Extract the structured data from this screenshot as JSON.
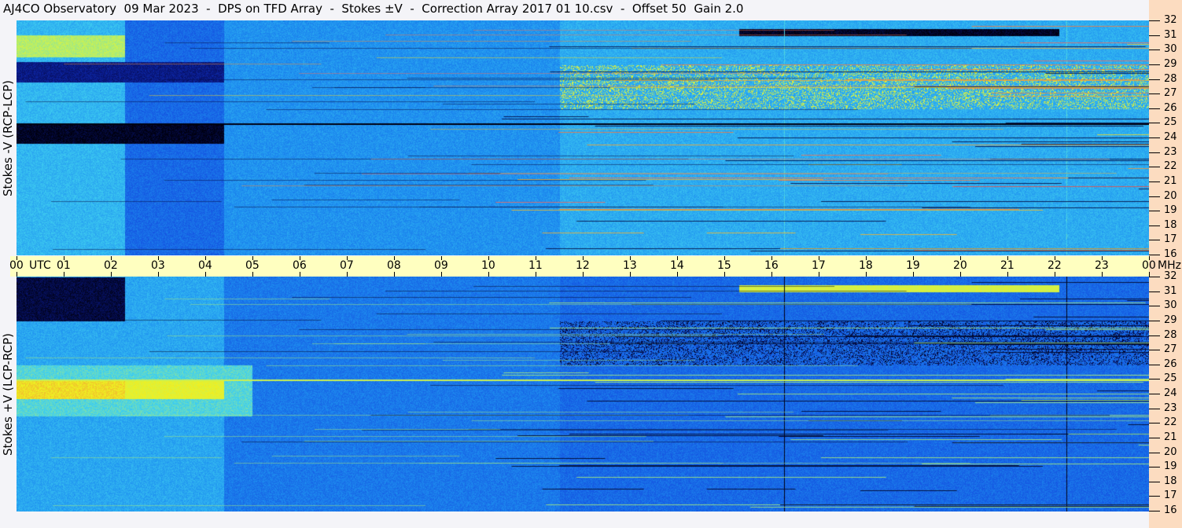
{
  "title": "AJ4CO Observatory  09 Mar 2023  -  DPS on TFD Array  -  Stokes ±V  -  Correction Array 2017 01 10.csv  -  Offset 50  Gain 2.0",
  "chart_data": {
    "type": "heatmap",
    "title": "AJ4CO Observatory  09 Mar 2023  -  DPS on TFD Array  -  Stokes ±V  -  Correction Array 2017 01 10.csv  -  Offset 50  Gain 2.0",
    "xlabel": "UTC",
    "ylabel_unit": "MHz",
    "x_ticks": [
      "00",
      "01",
      "02",
      "03",
      "04",
      "05",
      "06",
      "07",
      "08",
      "09",
      "10",
      "11",
      "12",
      "13",
      "14",
      "15",
      "16",
      "17",
      "18",
      "19",
      "20",
      "21",
      "22",
      "23",
      "00"
    ],
    "xlim_hours": [
      0,
      24
    ],
    "y_ticks": [
      32,
      31,
      30,
      29,
      28,
      27,
      26,
      25,
      24,
      23,
      22,
      21,
      20,
      19,
      18,
      17,
      16
    ],
    "ylim_mhz": [
      16,
      32
    ],
    "panels": [
      {
        "name": "Stokes -V (RCP-LCP)",
        "label": "Stokes -V (RCP-LCP)"
      },
      {
        "name": "Stokes +V (LCP-RCP)",
        "label": "Stokes +V (LCP-RCP)"
      }
    ],
    "colormap": [
      "#000010",
      "#0a1a8c",
      "#1450e0",
      "#1e90f0",
      "#40d0f0",
      "#c0f060",
      "#f0f020",
      "#f08040",
      "#f040a0"
    ]
  },
  "axis": {
    "utc_label": "UTC",
    "mhz_label": "MHz"
  },
  "colors": {
    "time_axis_bg": "#ffffc0",
    "freq_axis_bg": "#fcdcc0",
    "title_bg": "#f4f4f8"
  }
}
